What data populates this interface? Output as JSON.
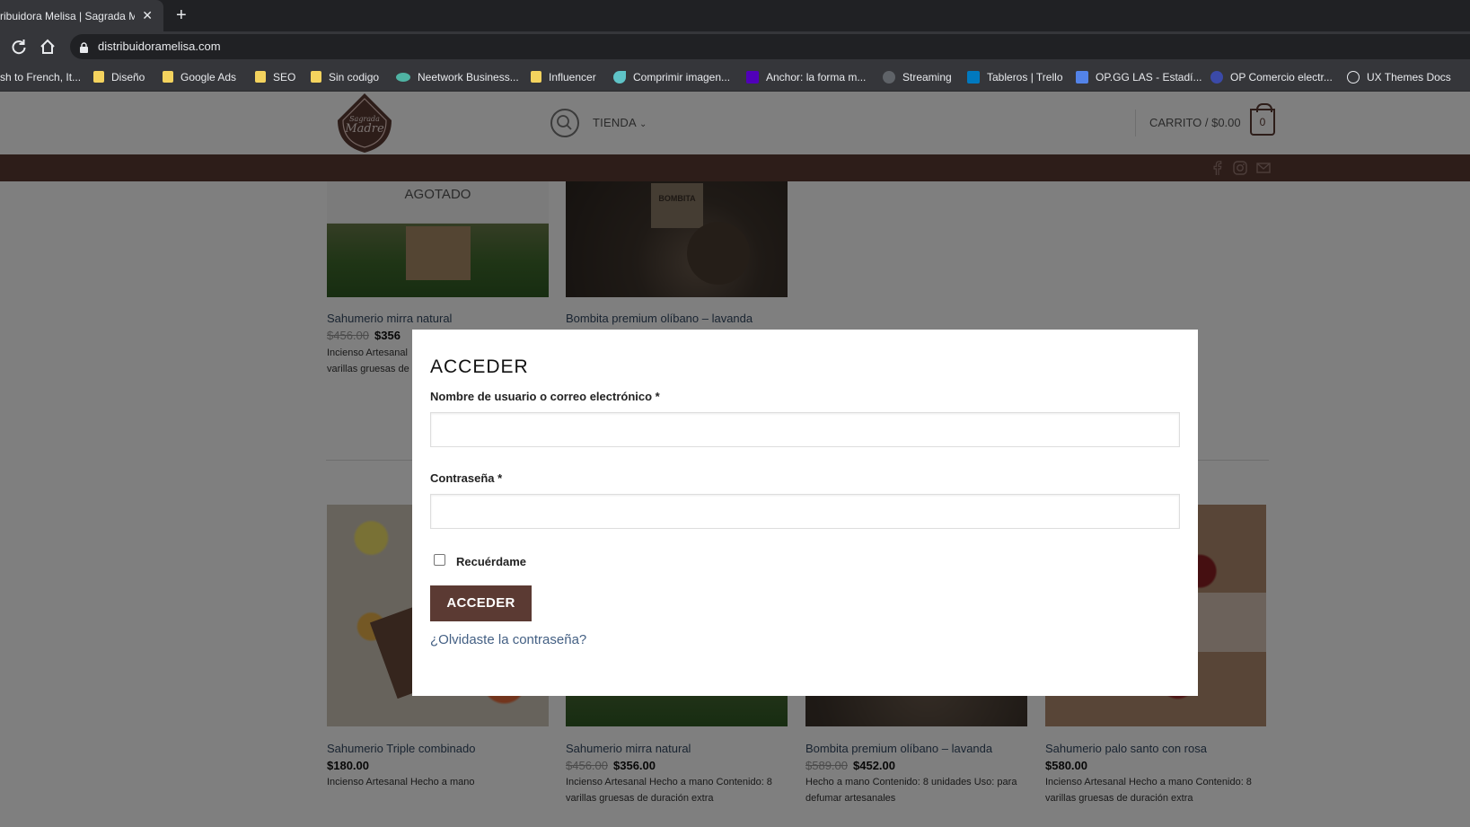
{
  "browser": {
    "tab_title": "ribuidora Melisa | Sagrada M",
    "tab_close": "✕",
    "new_tab": "+",
    "url": "distribuidoramelisa.com",
    "bookmarks": [
      {
        "label": "sh to French, It...",
        "icon": "translate-icon"
      },
      {
        "label": "Diseño",
        "icon": "folder-icon"
      },
      {
        "label": "Google Ads",
        "icon": "folder-icon"
      },
      {
        "label": "SEO",
        "icon": "folder-icon"
      },
      {
        "label": "Sin codigo",
        "icon": "folder-icon"
      },
      {
        "label": "Neetwork Business...",
        "icon": "neetwork-icon"
      },
      {
        "label": "Influencer",
        "icon": "folder-icon"
      },
      {
        "label": "Comprimir imagen...",
        "icon": "compress-icon"
      },
      {
        "label": "Anchor: la forma m...",
        "icon": "anchor-icon"
      },
      {
        "label": "Streaming",
        "icon": "globe-icon"
      },
      {
        "label": "Tableros | Trello",
        "icon": "trello-icon"
      },
      {
        "label": "OP.GG LAS - Estadí...",
        "icon": "opgg-icon"
      },
      {
        "label": "OP Comercio electr...",
        "icon": "op-icon"
      },
      {
        "label": "UX Themes Docs",
        "icon": "ux-icon"
      }
    ]
  },
  "header": {
    "logo_text_top": "Sagrada",
    "logo_text_main": "Madre",
    "nav_tienda": "TIENDA",
    "cart_label": "CARRITO / $0.00",
    "cart_count": "0"
  },
  "products_top": [
    {
      "badge": "AGOTADO",
      "title": "Sahumerio mirra natural",
      "old_price": "$456.00",
      "price": "$356",
      "desc": "Incienso Artesanal\nvarillas gruesas de"
    },
    {
      "title": "Bombita premium olíbano – lavanda",
      "bag_text": "BOMBITA"
    }
  ],
  "products_bottom": [
    {
      "title": "Sahumerio Triple combinado",
      "old_price": "",
      "price": "$180.00",
      "desc": "Incienso Artesanal Hecho a mano"
    },
    {
      "title": "Sahumerio mirra natural",
      "old_price": "$456.00",
      "price": "$356.00",
      "desc": "Incienso Artesanal Hecho a mano Contenido: 8 varillas gruesas de duración extra"
    },
    {
      "title": "Bombita premium olíbano – lavanda",
      "old_price": "$589.00",
      "price": "$452.00",
      "desc": "Hecho a mano Contenido: 8 unidades Uso: para defumar artesanales"
    },
    {
      "title": "Sahumerio palo santo con rosa",
      "old_price": "",
      "price": "$580.00",
      "desc": "Incienso Artesanal Hecho a mano Contenido: 8 varillas gruesas de duración extra"
    }
  ],
  "modal": {
    "title": "ACCEDER",
    "username_label": "Nombre de usuario o correo electrónico *",
    "password_label": "Contraseña *",
    "remember_label": "Recuérdame",
    "submit_label": "ACCEDER",
    "forgot_link": "¿Olvidaste la contraseña?"
  },
  "colors": {
    "brand": "#5b3a33",
    "link": "#446084",
    "chrome_dark": "#202124",
    "chrome_toolbar": "#35363a"
  }
}
